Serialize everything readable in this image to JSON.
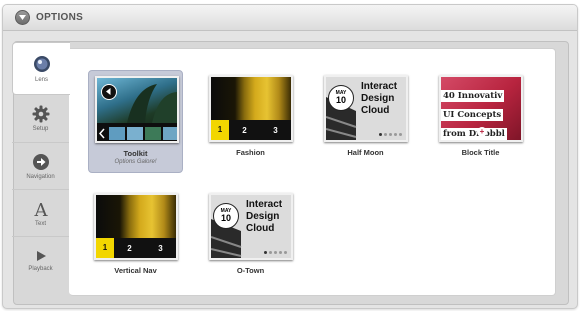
{
  "header": {
    "title": "OPTIONS"
  },
  "sidebar": {
    "items": [
      {
        "label": "Lens",
        "icon": "lens-icon",
        "active": true
      },
      {
        "label": "Setup",
        "icon": "gear-icon",
        "active": false
      },
      {
        "label": "Navigation",
        "icon": "arrow-right-circle-icon",
        "active": false
      },
      {
        "label": "Text",
        "icon": "text-a-icon",
        "active": false
      },
      {
        "label": "Playback",
        "icon": "play-icon",
        "active": false
      }
    ]
  },
  "lenses": [
    {
      "label": "Toolkit",
      "subtitle": "Options Galore!",
      "selected": true
    },
    {
      "label": "Fashion",
      "numbers": [
        "1",
        "2",
        "3"
      ]
    },
    {
      "label": "Half Moon",
      "month": "MAY",
      "day": "10",
      "lines": [
        "Interact",
        "Design",
        "Cloud"
      ]
    },
    {
      "label": "Block Title",
      "lines": [
        "40 Innovativ",
        "UI Concepts",
        "from Dribbbl"
      ]
    },
    {
      "label": "Vertical Nav",
      "numbers": [
        "1",
        "2",
        "3"
      ]
    },
    {
      "label": "O-Town",
      "month": "MAY",
      "day": "10",
      "lines": [
        "Interact",
        "Design",
        "Cloud"
      ]
    }
  ],
  "colors": {
    "accent_yellow": "#f2d600",
    "selected_tile": "#c6cad8",
    "block_bg": "#c4314f"
  }
}
